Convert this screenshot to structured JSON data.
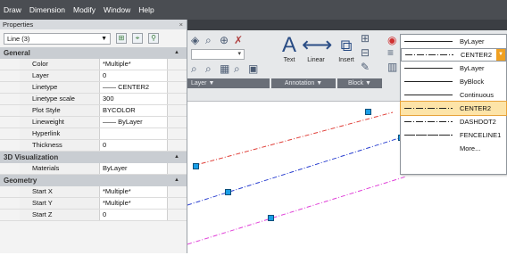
{
  "menu": [
    "Draw",
    "Dimension",
    "Modify",
    "Window",
    "Help"
  ],
  "properties_palette": {
    "title": "Properties",
    "close_glyph": "×",
    "selection": "Line (3)",
    "sections": {
      "general": "General",
      "viz3d": "3D Visualization",
      "geometry": "Geometry"
    },
    "general_rows": [
      {
        "label": "Color",
        "value": "*Multiple*"
      },
      {
        "label": "Layer",
        "value": "0"
      },
      {
        "label": "Linetype",
        "value": "—— CENTER2"
      },
      {
        "label": "Linetype scale",
        "value": "300"
      },
      {
        "label": "Plot Style",
        "value": "BYCOLOR"
      },
      {
        "label": "Lineweight",
        "value": "—— ByLayer"
      },
      {
        "label": "Hyperlink",
        "value": ""
      },
      {
        "label": "Thickness",
        "value": "0"
      }
    ],
    "viz_rows": [
      {
        "label": "Materials",
        "value": "ByLayer"
      }
    ],
    "geometry_rows": [
      {
        "label": "Start X",
        "value": "*Multiple*"
      },
      {
        "label": "Start Y",
        "value": "*Multiple*"
      },
      {
        "label": "Start Z",
        "value": "0"
      }
    ]
  },
  "ribbon": {
    "panels": [
      "Layer ▼",
      "Annotation ▼",
      "Block ▼"
    ],
    "text_label": "Text",
    "linear_label": "Linear",
    "insert_label": "Insert"
  },
  "linetype_dropdown": {
    "top_value": "ByLayer",
    "current_value": "CENTER2",
    "items": [
      "ByLayer",
      "ByBlock",
      "Continuous",
      "CENTER2",
      "DASHDOT2",
      "FENCELINE1",
      "More..."
    ],
    "selected": "CENTER2"
  },
  "colors": {
    "menubar": "#4a4d52",
    "line_red": "#e0403a",
    "line_blue": "#2a3fd0",
    "line_magenta": "#e040d8",
    "grip": "#1a9ee6",
    "selected_item": "#fde4a8"
  }
}
